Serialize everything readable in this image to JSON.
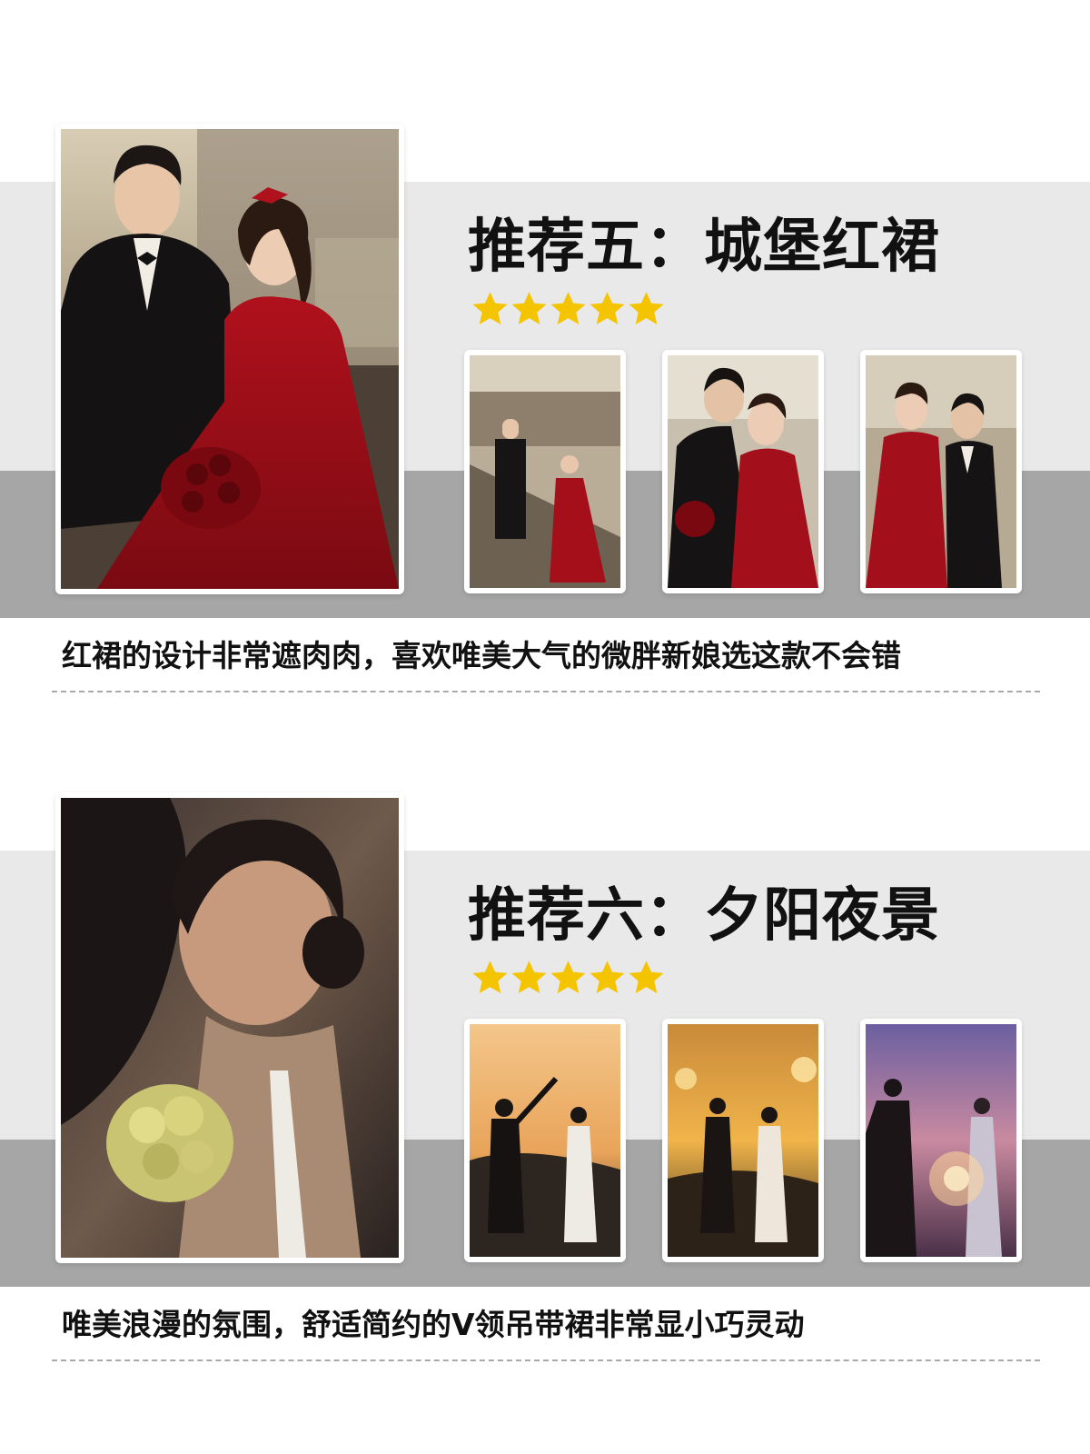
{
  "colors": {
    "band_light": "#e9e9e9",
    "band_dark": "#a6a6a6",
    "star": "#f5c400",
    "text": "#111111",
    "dash": "#a9a9a9"
  },
  "sections": [
    {
      "title": "推荐五：城堡红裙",
      "rating": 5,
      "description": "红裙的设计非常遮肉肉，喜欢唯美大气的微胖新娘选这款不会错",
      "photos": [
        "couple-red-dress-castle-main",
        "castle-stairs-couple",
        "couple-embrace-castle",
        "couple-side-by-side-castle"
      ]
    },
    {
      "title": "推荐六：夕阳夜景",
      "rating": 5,
      "description": "唯美浪漫的氛围，舒适简约的V领吊带裙非常显小巧灵动",
      "photos": [
        "bride-sunset-closeup-main",
        "couple-dancing-sunset",
        "couple-sparklers-dusk",
        "couple-sparklers-twilight"
      ]
    }
  ]
}
